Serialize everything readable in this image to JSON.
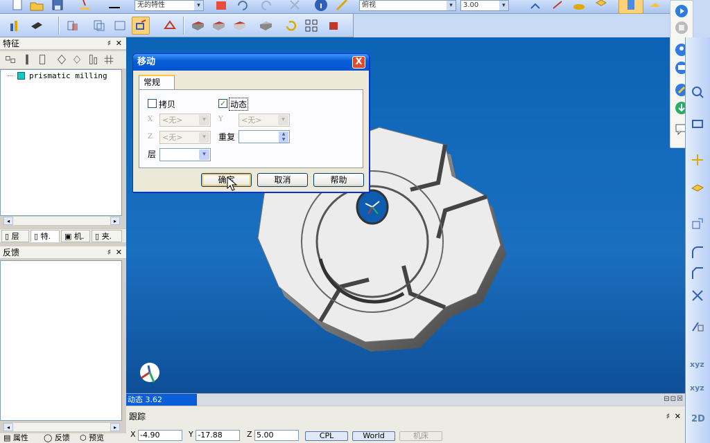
{
  "toolbar_top": {
    "combo1": "无的特性",
    "combo2": "俯视",
    "combo3": "3.00"
  },
  "panels": {
    "features": {
      "title": "特征",
      "tree": [
        {
          "label": "prismatic milling"
        }
      ]
    },
    "left_tabs": [
      {
        "label": "层",
        "active": false
      },
      {
        "label": "特.",
        "active": true
      },
      {
        "label": "机.",
        "active": false
      },
      {
        "label": "夹.",
        "active": false
      }
    ],
    "feedback": {
      "title": "反馈"
    },
    "bottom_tabs": [
      {
        "label": "属性"
      },
      {
        "label": "反馈"
      },
      {
        "label": "预览"
      }
    ]
  },
  "dialog": {
    "title": "移动",
    "close": "X",
    "tab": "常规",
    "copy_label": "拷贝",
    "copy_checked": false,
    "dynamic_label": "动态",
    "dynamic_checked": true,
    "x_label": "X",
    "y_label": "Y",
    "z_label": "Z",
    "x_value": "<无>",
    "y_value": "<无>",
    "z_value": "<无>",
    "repeat_label": "重复",
    "layer_label": "层",
    "ok": "确定",
    "cancel": "取消",
    "help": "帮助"
  },
  "status": {
    "mode_text": "动态 3.62"
  },
  "trace": {
    "title": "跟踪",
    "x_label": "X",
    "x_value": "-4.90",
    "y_label": "Y",
    "y_value": "-17.88",
    "z_label": "Z",
    "z_value": "5.00",
    "cpl": "CPL",
    "world": "World",
    "machine": "机床"
  },
  "right_bar": {
    "xyz1": "xyz",
    "xyz2": "xyz",
    "mode2d": "2D"
  },
  "icons": {
    "accent": "#0a5fd8",
    "viewport_bg": "#1a6fbf",
    "highlight": "#ffd27a"
  }
}
